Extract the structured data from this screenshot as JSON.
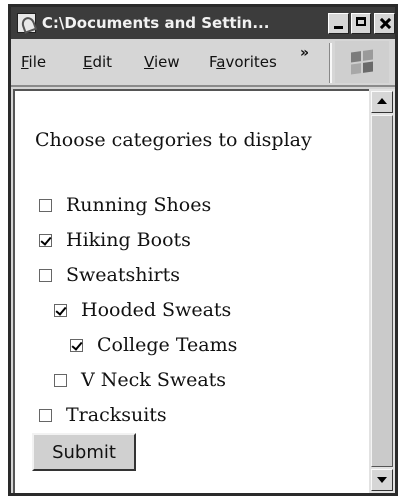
{
  "window": {
    "title": "C:\\Documents and Settin..."
  },
  "menubar": {
    "items": [
      "File",
      "Edit",
      "View",
      "Favorites"
    ],
    "more_label": "»",
    "throbber_icon": "windows-flag-icon"
  },
  "page": {
    "heading": "Choose categories to display",
    "categories": [
      {
        "label": "Running Shoes",
        "checked": false
      },
      {
        "label": "Hiking Boots",
        "checked": true
      },
      {
        "label": "Sweatshirts",
        "checked": false
      },
      {
        "label": "Hooded Sweats",
        "checked": true
      },
      {
        "label": "College Teams",
        "checked": true
      },
      {
        "label": "V Neck Sweats",
        "checked": false
      },
      {
        "label": "Tracksuits",
        "checked": false
      }
    ],
    "submit_label": "Submit"
  },
  "scrollbar": {
    "icons": [
      "scroll-up-arrow-icon",
      "scroll-down-arrow-icon"
    ]
  },
  "colors": {
    "title_bar": "#3c3c3c",
    "window_face": "#d6d6d6"
  }
}
